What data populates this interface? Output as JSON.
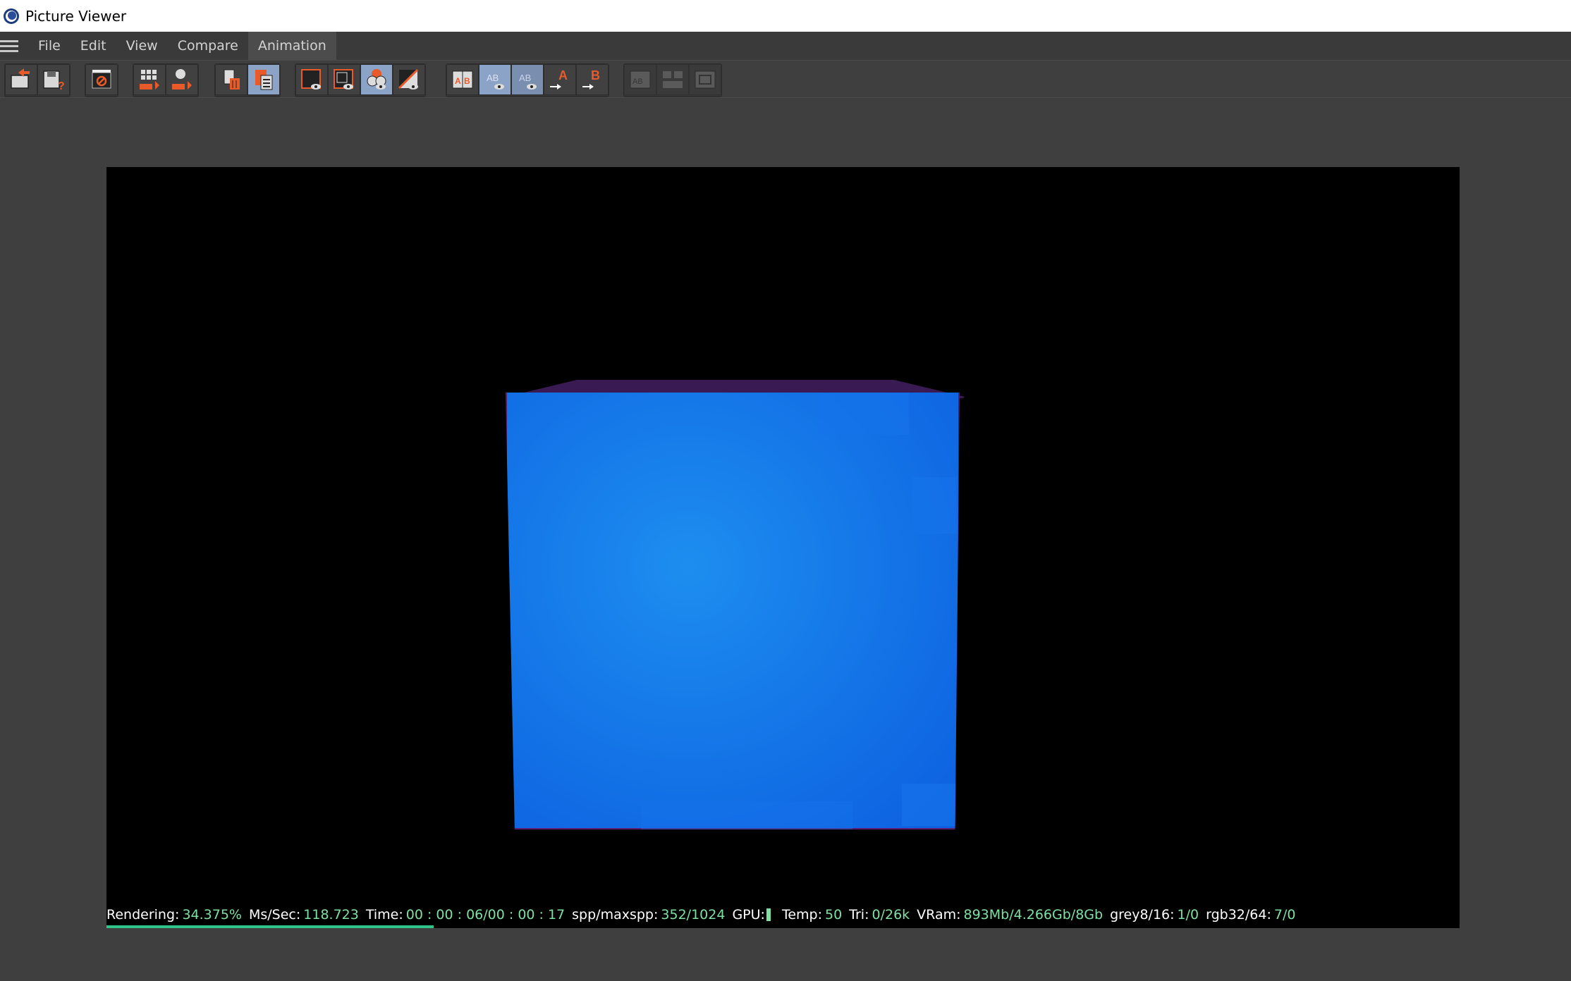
{
  "window": {
    "title": "Picture Viewer"
  },
  "menu": {
    "items": [
      {
        "label": "File"
      },
      {
        "label": "Edit"
      },
      {
        "label": "View"
      },
      {
        "label": "Compare"
      },
      {
        "label": "Animation"
      }
    ],
    "active": "Animation"
  },
  "toolbar": {
    "labels": {
      "a": "A",
      "b": "B",
      "ab": "AB"
    }
  },
  "status": {
    "rendering_label": "Rendering:",
    "rendering_value": "34.375%",
    "ms_label": "Ms/Sec:",
    "ms_value": "118.723",
    "time_label": "Time:",
    "time_value": "00 : 00 : 06/00 : 00 : 17",
    "spp_label": "spp/maxspp:",
    "spp_value": "352/1024",
    "gpu_label": "GPU:",
    "temp_label": "Temp:",
    "temp_value": "50",
    "tri_label": "Tri:",
    "tri_value": "0/26k",
    "vram_label": "VRam:",
    "vram_value": "893Mb/4.266Gb/8Gb",
    "grey_label": "grey8/16:",
    "grey_value": "1/0",
    "rgb_label": "rgb32/64:",
    "rgb_value": "7/0",
    "progress": 0.34375
  },
  "colors": {
    "accent_green": "#7fe0a4",
    "progress_bar": "#2fc58a",
    "cube_blue": "#1578e8",
    "toolbar_orange": "#e85a2a"
  }
}
